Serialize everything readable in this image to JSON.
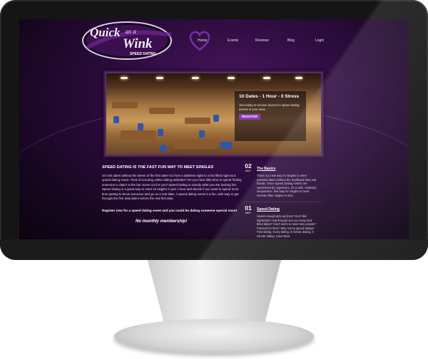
{
  "logo": {
    "line1": "Quick",
    "line2": "as a",
    "line3": "Wink",
    "tagline": "SPEED DATING"
  },
  "nav": {
    "items": [
      {
        "label": "Home"
      },
      {
        "label": "Events"
      },
      {
        "label": "Reviews"
      },
      {
        "label": "Blog"
      },
      {
        "label": "Login"
      }
    ]
  },
  "hero": {
    "title": "10 Dates - 1 Hour - 0 Stress",
    "text": "Join today to receive access to speed dating events in your area.",
    "register_label": "REGISTER"
  },
  "main": {
    "title": "SPEED DATING IS THE FAST FUN WAY TO MEET SINGLES",
    "body": "10 mini dates without the stress of the first date! Go from a dateless night to a fun filled night at a speed dating event. Tired of scouring online dating websites? Do you have little time to spend finding someone to date? Is the bar scene not for you? Speed Dating is exactly what you are looking for! Speed dating is a great way to meet 10 singles in just 1 hour and decide if you want to spend more time getting to know someone and go on a real date. A speed dating event is a fun, safe way to get through the first date jitters before the real first date.",
    "cta_bold": "Register",
    "cta_rest": " now for a speed dating event and you could be dating someone special soon!",
    "tagline": "No monthly membership!"
  },
  "posts": [
    {
      "day": "02",
      "month": "MAY",
      "title": "The Basics",
      "text": "There is a new way for singles to meet potential dates without the traditional time and hassle. Since Speed Dating events are supervised by organizers, it's a safe, relatively inexpensive, fast way for singles to meet several other singles in and..."
    },
    {
      "day": "01",
      "month": "MAY",
      "title": "Speed Dating",
      "text": "Heard enough pick-up lines? Don't like nightclubs? Sat through one too many bad blind dates? Can't seem to meet new people? Pressed for time? Why not try speed dating? Fast dating. Hurry dating. 8 minute dating. 6 minute dating. Cave Bear."
    }
  ],
  "colors": {
    "accent": "#8b3fb0",
    "background": "#2a0b3a",
    "text": "#ffffff"
  }
}
